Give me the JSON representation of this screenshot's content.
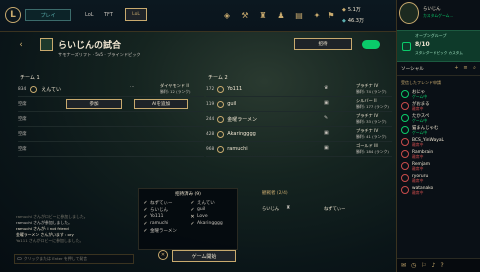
{
  "topbar": {
    "play_label": "プレイ",
    "nav": [
      "LoL",
      "TFT"
    ],
    "rank_badge": "LoL",
    "rp": "5.1万",
    "be": "46.3万"
  },
  "profile": {
    "name": "らいじん",
    "status": "カスタムゲーム..."
  },
  "lobby": {
    "title": "らいじんの試合",
    "subtitle": "サモナーズリフト · 5v5 · ブラインドピック",
    "invite_label": "招待",
    "team1_header": "チーム 1",
    "team2_header": "チーム 2",
    "team1": [
      {
        "id": "834",
        "name": "えんてい",
        "rank": "ダイヤモンド II",
        "lp": "勝利: 12 (ランク)"
      }
    ],
    "team1_empty_slots": [
      "空席",
      "空席",
      "空席",
      "空席"
    ],
    "join_label": "参加",
    "bot_label": "AIを追加",
    "team2": [
      {
        "id": "172",
        "name": "Yo111",
        "rank": "プラチナ IV",
        "lp": "勝利: 74 (ランク)"
      },
      {
        "id": "119",
        "name": "guil",
        "rank": "シルバー II",
        "lp": "勝利: 177 (ランク)"
      },
      {
        "id": "244",
        "name": "金曜ラーメン",
        "rank": "プラチナ IV",
        "lp": "勝利: 33 (ランク)"
      },
      {
        "id": "428",
        "name": "Akaringggg",
        "rank": "プラチナ IV",
        "lp": "勝利: 41 (ランク)"
      },
      {
        "id": "968",
        "name": "ramuchi",
        "rank": "ゴールド III",
        "lp": "勝利: 184 (ランク)"
      }
    ]
  },
  "chat": {
    "lines": [
      "ramuchi さんがロビーに参加しました。",
      "ramuchi さんが参加しました。",
      "ramuchi さんが: I not friend",
      "金曜ラーメン さんがいます : ory",
      "Yo111 さんがロビーに参加しました。"
    ],
    "placeholder": "クリックまたは Enter を押して発言"
  },
  "ready_panel": {
    "title": "招待済み (9)",
    "players": [
      "ねずてぃー",
      "えんてい",
      "らいじん",
      "guil",
      "Yo111",
      "Love",
      "ramuchi",
      "Akaringggg",
      "金曜ラーメン"
    ]
  },
  "spectators": {
    "title": "観戦者 (2/4)",
    "names": [
      "らいじん",
      "ねずてぃー"
    ]
  },
  "start_label": "ゲーム開始",
  "social": {
    "group_label": "オープングループ",
    "group_count": "8/10",
    "group_sub": "スタンダードピック カスタム",
    "header": "ソーシャル",
    "section": "受信したフレンド申請",
    "friends": [
      {
        "name": "おにゃ",
        "status": "ゲーム中"
      },
      {
        "name": "がおまる",
        "status": "離席中"
      },
      {
        "name": "たかスペ",
        "status": "ゲーム中"
      },
      {
        "name": "猫まんじゃむ",
        "status": "ゲーム中"
      },
      {
        "name": "BCS_YinWayaL",
        "status": "離席中"
      },
      {
        "name": "Rambrain",
        "status": "離席中"
      },
      {
        "name": "Remjam",
        "status": "離席中"
      },
      {
        "name": "ryoruru",
        "status": "離席中"
      },
      {
        "name": "watanako",
        "status": "離席中"
      }
    ]
  },
  "colors": {
    "gold": "#c8aa6e",
    "online": "#0acb6a",
    "away": "#c84b4b"
  }
}
